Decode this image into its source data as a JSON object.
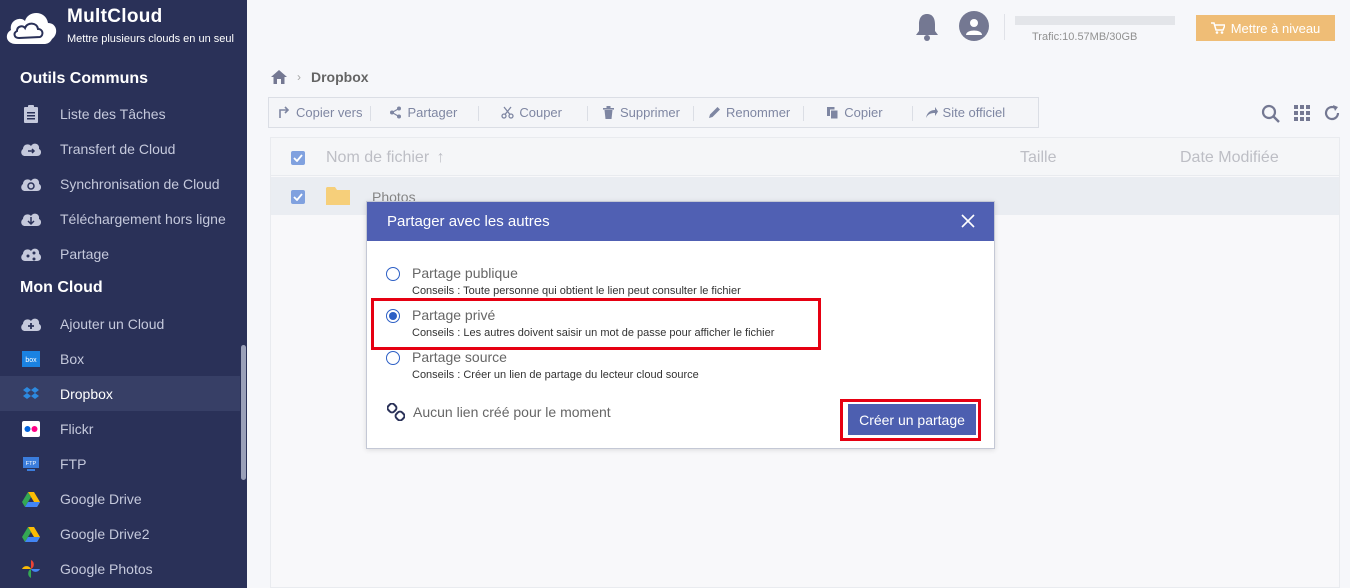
{
  "app": {
    "name": "MultCloud",
    "tagline": "Mettre plusieurs clouds en un seul"
  },
  "sidebar": {
    "section_tools": "Outils Communs",
    "tools": [
      {
        "label": "Liste des Tâches",
        "icon": "clipboard-icon"
      },
      {
        "label": "Transfert de Cloud",
        "icon": "cloud-transfer-icon"
      },
      {
        "label": "Synchronisation de Cloud",
        "icon": "cloud-sync-icon"
      },
      {
        "label": "Téléchargement hors ligne",
        "icon": "cloud-download-icon"
      },
      {
        "label": "Partage",
        "icon": "cloud-share-icon"
      }
    ],
    "section_clouds": "Mon Cloud",
    "clouds": [
      {
        "label": "Ajouter un Cloud",
        "icon": "cloud-add-icon"
      },
      {
        "label": "Box",
        "icon": "box-icon"
      },
      {
        "label": "Dropbox",
        "icon": "dropbox-icon",
        "active": true
      },
      {
        "label": "Flickr",
        "icon": "flickr-icon"
      },
      {
        "label": "FTP",
        "icon": "ftp-icon"
      },
      {
        "label": "Google Drive",
        "icon": "google-drive-icon"
      },
      {
        "label": "Google Drive2",
        "icon": "google-drive-icon"
      },
      {
        "label": "Google Photos",
        "icon": "google-photos-icon"
      }
    ]
  },
  "header": {
    "traffic": "Trafic:10.57MB/30GB",
    "upgrade_label": "Mettre à niveau"
  },
  "breadcrumb": {
    "current": "Dropbox"
  },
  "toolbar": {
    "buttons": [
      {
        "label": "Copier vers",
        "icon": "copy-to-icon"
      },
      {
        "label": "Partager",
        "icon": "share-icon"
      },
      {
        "label": "Couper",
        "icon": "scissors-icon"
      },
      {
        "label": "Supprimer",
        "icon": "trash-icon"
      },
      {
        "label": "Renommer",
        "icon": "pencil-icon"
      },
      {
        "label": "Copier",
        "icon": "copy-icon"
      },
      {
        "label": "Site officiel",
        "icon": "external-link-icon"
      }
    ]
  },
  "file_table": {
    "columns": {
      "name": "Nom de fichier",
      "size": "Taille",
      "modified": "Date Modifiée"
    },
    "rows": [
      {
        "name": "Photos",
        "size": "",
        "modified": ""
      }
    ]
  },
  "share_dialog": {
    "title": "Partager avec les autres",
    "options": [
      {
        "label": "Partage publique",
        "hint": "Conseils : Toute personne qui obtient le lien peut consulter le fichier",
        "checked": false
      },
      {
        "label": "Partage privé",
        "hint": "Conseils : Les autres doivent saisir un mot de passe pour afficher le fichier",
        "checked": true
      },
      {
        "label": "Partage source",
        "hint": "Conseils : Créer un lien de partage du lecteur cloud source",
        "checked": false
      }
    ],
    "no_link_text": "Aucun lien créé pour le moment",
    "create_label": "Créer un partage"
  },
  "colors": {
    "sidebar_bg": "#2a3158",
    "modal_header": "#5060b3",
    "accent_blue": "#3d6fce",
    "upgrade_orange": "#e79a2d",
    "highlight_red": "#e60012"
  }
}
